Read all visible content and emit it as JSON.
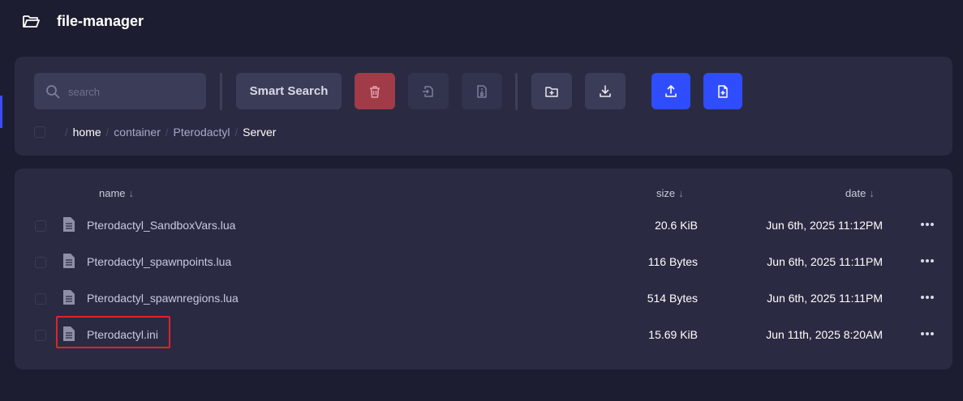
{
  "app": {
    "title": "file-manager"
  },
  "toolbar": {
    "search_placeholder": "search",
    "search_value": "",
    "smart_search_label": "Smart Search"
  },
  "breadcrumb": [
    "home",
    "container",
    "Pterodactyl",
    "Server"
  ],
  "columns": {
    "name": "name",
    "size": "size",
    "date": "date"
  },
  "files": [
    {
      "name": "Pterodactyl_SandboxVars.lua",
      "size": "20.6 KiB",
      "date": "Jun 6th, 2025 11:12PM"
    },
    {
      "name": "Pterodactyl_spawnpoints.lua",
      "size": "116 Bytes",
      "date": "Jun 6th, 2025 11:11PM"
    },
    {
      "name": "Pterodactyl_spawnregions.lua",
      "size": "514 Bytes",
      "date": "Jun 6th, 2025 11:11PM"
    },
    {
      "name": "Pterodactyl.ini",
      "size": "15.69 KiB",
      "date": "Jun 11th, 2025 8:20AM"
    }
  ],
  "icons": {
    "header": "folder-icon",
    "search": "search-icon",
    "delete": "trash-icon",
    "move": "move-file-icon",
    "compress": "archive-icon",
    "new_folder": "folder-plus-icon",
    "download": "download-icon",
    "upload": "upload-icon",
    "new_file": "file-plus-icon",
    "file": "file-icon",
    "row_menu": "more-horizontal-icon"
  },
  "colors": {
    "background": "#1c1d30",
    "card": "#2a2b42",
    "primary": "#2f4dff",
    "danger": "#a13b48",
    "highlight_border": "#e0222b"
  }
}
